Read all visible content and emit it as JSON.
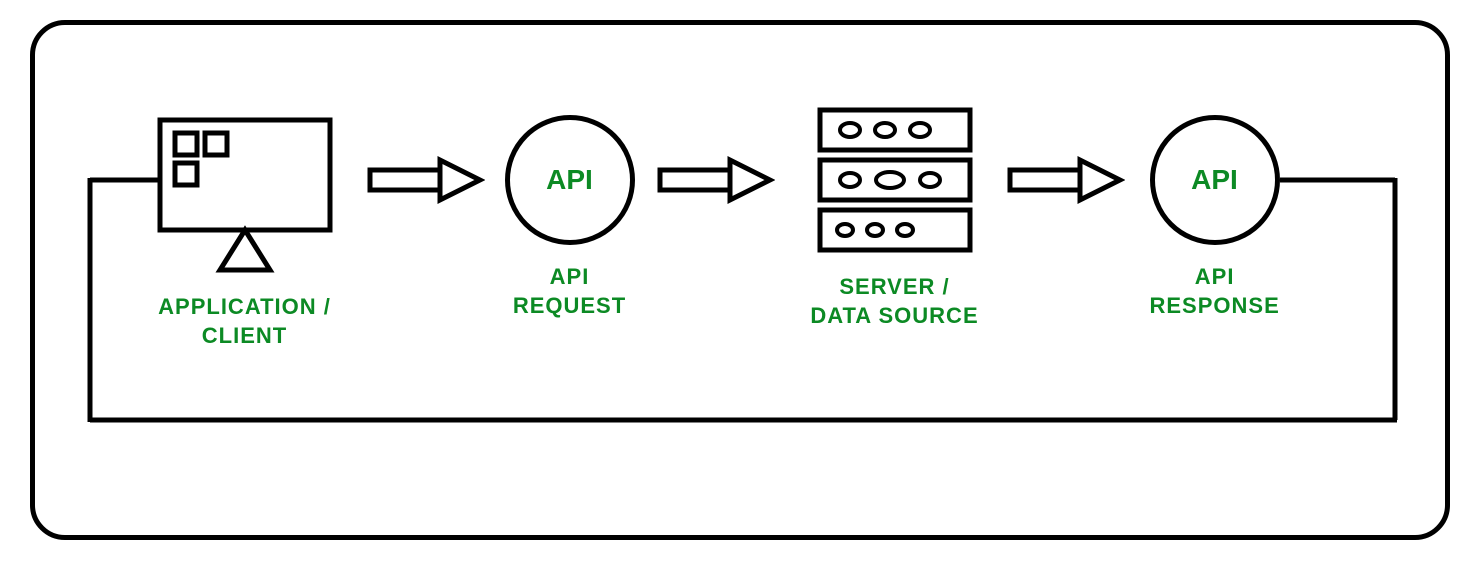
{
  "nodes": {
    "client": {
      "label": "APPLICATION /\nCLIENT"
    },
    "request": {
      "api_text": "API",
      "label": "API\nREQUEST"
    },
    "server": {
      "label": "SERVER /\nDATA SOURCE"
    },
    "response": {
      "api_text": "API",
      "label": "API\nRESPONSE"
    }
  }
}
